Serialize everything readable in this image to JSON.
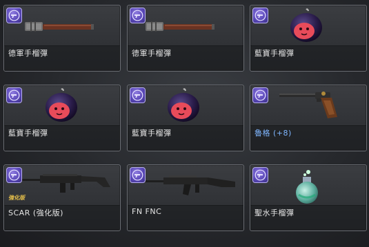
{
  "inventory": {
    "items": [
      {
        "name": "德軍手榴彈",
        "icon": "german-grenade-icon",
        "slot_icon": "revolver-icon"
      },
      {
        "name": "德軍手榴彈",
        "icon": "german-grenade-icon",
        "slot_icon": "revolver-icon"
      },
      {
        "name": "藍寶手榴彈",
        "icon": "bomb-grenade-icon",
        "slot_icon": "revolver-icon"
      },
      {
        "name": "藍寶手榴彈",
        "icon": "bomb-grenade-icon",
        "slot_icon": "revolver-icon"
      },
      {
        "name": "藍寶手榴彈",
        "icon": "bomb-grenade-icon",
        "slot_icon": "revolver-icon"
      },
      {
        "name": "魯格 (+8)",
        "icon": "luger-pistol-icon",
        "slot_icon": "revolver-icon",
        "name_color": "#7fb6ff"
      },
      {
        "name": "SCAR (強化版)",
        "icon": "scar-rifle-icon",
        "slot_icon": "revolver-icon",
        "tag": "強化版",
        "tag_color": "#e9c24b"
      },
      {
        "name": "FN FNC",
        "icon": "fn-fnc-rifle-icon",
        "slot_icon": "revolver-icon"
      },
      {
        "name": "聖水手榴彈",
        "icon": "holy-water-flask-icon",
        "slot_icon": "revolver-icon"
      }
    ]
  },
  "colors": {
    "badge": "#5a48b8",
    "name_text": "#e6e6e6",
    "enhanced_name": "#7fb6ff",
    "enhanced_tag": "#e9c24b"
  }
}
